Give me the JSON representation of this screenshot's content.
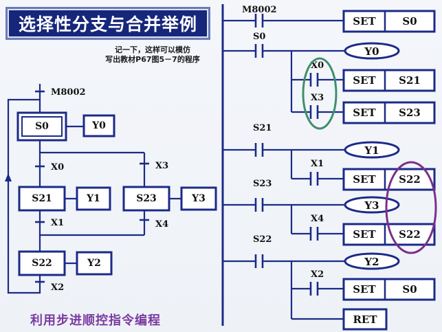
{
  "title": "选择性分支与合并举例",
  "note": {
    "line1": "记一下，这样可以模仿",
    "line2": "写出教材P67图5－7的程序"
  },
  "caption": "利用步进顺控指令编程",
  "sfc": {
    "init_label": "M8002",
    "steps": [
      "S0",
      "S21",
      "S23",
      "S22"
    ],
    "outputs": [
      "Y0",
      "Y1",
      "Y3",
      "Y2"
    ],
    "transitions": [
      "X0",
      "X3",
      "X1",
      "X4",
      "X2"
    ]
  },
  "ladder": {
    "contacts": [
      "M8002",
      "S0",
      "X0",
      "X3",
      "S21",
      "X1",
      "S23",
      "X4",
      "S22",
      "X2"
    ],
    "coils": [
      "Y0",
      "Y1",
      "Y3",
      "Y2"
    ],
    "commands": [
      {
        "op": "SET",
        "arg": "S0"
      },
      {
        "op": "SET",
        "arg": "S21"
      },
      {
        "op": "SET",
        "arg": "S23"
      },
      {
        "op": "SET",
        "arg": "S22"
      },
      {
        "op": "SET",
        "arg": "S22"
      },
      {
        "op": "SET",
        "arg": "S0"
      },
      {
        "op": "RET"
      }
    ]
  },
  "colors": {
    "line": "#1b2a88",
    "banner": "#16267a",
    "caption": "#7a3aa0",
    "highlight_green": "#3f8f6a",
    "highlight_purple": "#7a2f8a"
  }
}
